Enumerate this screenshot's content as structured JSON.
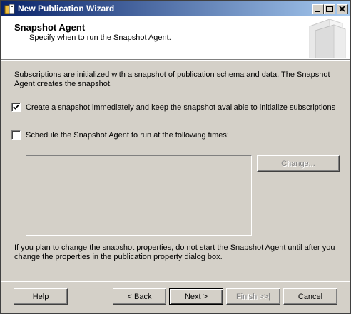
{
  "window": {
    "title": "New Publication Wizard",
    "controls": {
      "minimize": "minimize-icon",
      "maximize": "maximize-icon",
      "close": "close-icon"
    }
  },
  "header": {
    "title": "Snapshot Agent",
    "subtitle": "Specify when to run the Snapshot Agent."
  },
  "body": {
    "description": "Subscriptions are initialized with a snapshot of publication schema and data. The Snapshot Agent creates the snapshot.",
    "create_snapshot": {
      "label": "Create a snapshot immediately and keep the snapshot available to initialize subscriptions",
      "checked": true
    },
    "schedule": {
      "label": "Schedule the Snapshot Agent to run at the following times:",
      "checked": false
    },
    "change_button": "Change...",
    "note": "If you plan to change the snapshot properties, do not start the Snapshot Agent until after you change the properties in the publication property dialog box."
  },
  "footer": {
    "help": "Help",
    "back": "< Back",
    "next": "Next >",
    "finish": "Finish >>|",
    "cancel": "Cancel"
  },
  "colors": {
    "titlebar_start": "#0a246a",
    "titlebar_end": "#a6caf0",
    "face": "#d4d0c8"
  }
}
